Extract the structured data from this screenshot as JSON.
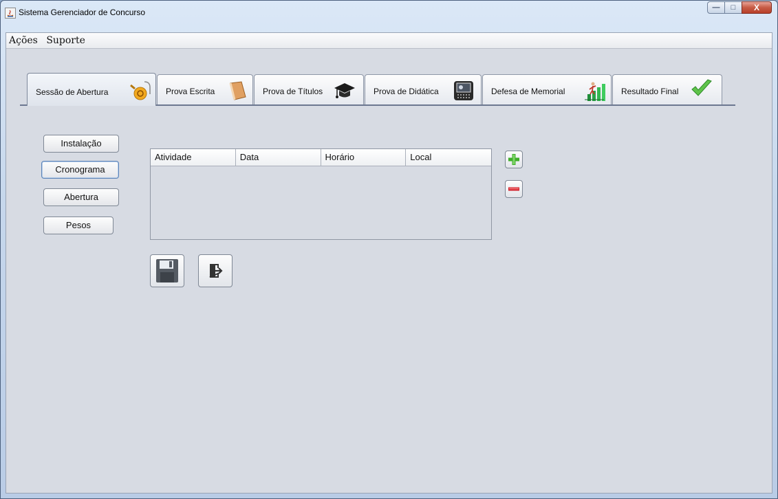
{
  "window": {
    "title": "Sistema Gerenciador de Concurso",
    "minimize_glyph": "—",
    "maximize_glyph": "□",
    "close_glyph": "X"
  },
  "menubar": {
    "items": [
      "Ações",
      "Suporte"
    ]
  },
  "tabs": [
    {
      "label": "Sessão de Abertura",
      "icon": "lock-key-icon",
      "active": true
    },
    {
      "label": "Prova Escrita",
      "icon": "book-icon",
      "active": false
    },
    {
      "label": "Prova de Títulos",
      "icon": "graduation-cap-icon",
      "active": false
    },
    {
      "label": "Prova de Didática",
      "icon": "projector-icon",
      "active": false
    },
    {
      "label": "Defesa de Memorial",
      "icon": "growth-chart-icon",
      "active": false
    },
    {
      "label": "Resultado Final",
      "icon": "checkmark-icon",
      "active": false
    }
  ],
  "side_menu": {
    "installation": "Instalação",
    "schedule": "Cronograma",
    "opening": "Abertura",
    "weights": "Pesos"
  },
  "table": {
    "columns": [
      "Atividade",
      "Data",
      "Horário",
      "Local"
    ],
    "rows": []
  },
  "actions": {
    "add_icon": "plus-icon",
    "remove_icon": "minus-icon",
    "save_icon": "floppy-disk-icon",
    "exit_icon": "exit-door-icon"
  },
  "colors": {
    "add_green": "#3fae2a",
    "remove_red": "#d2202a",
    "panel_bg": "#d7dbe3"
  }
}
